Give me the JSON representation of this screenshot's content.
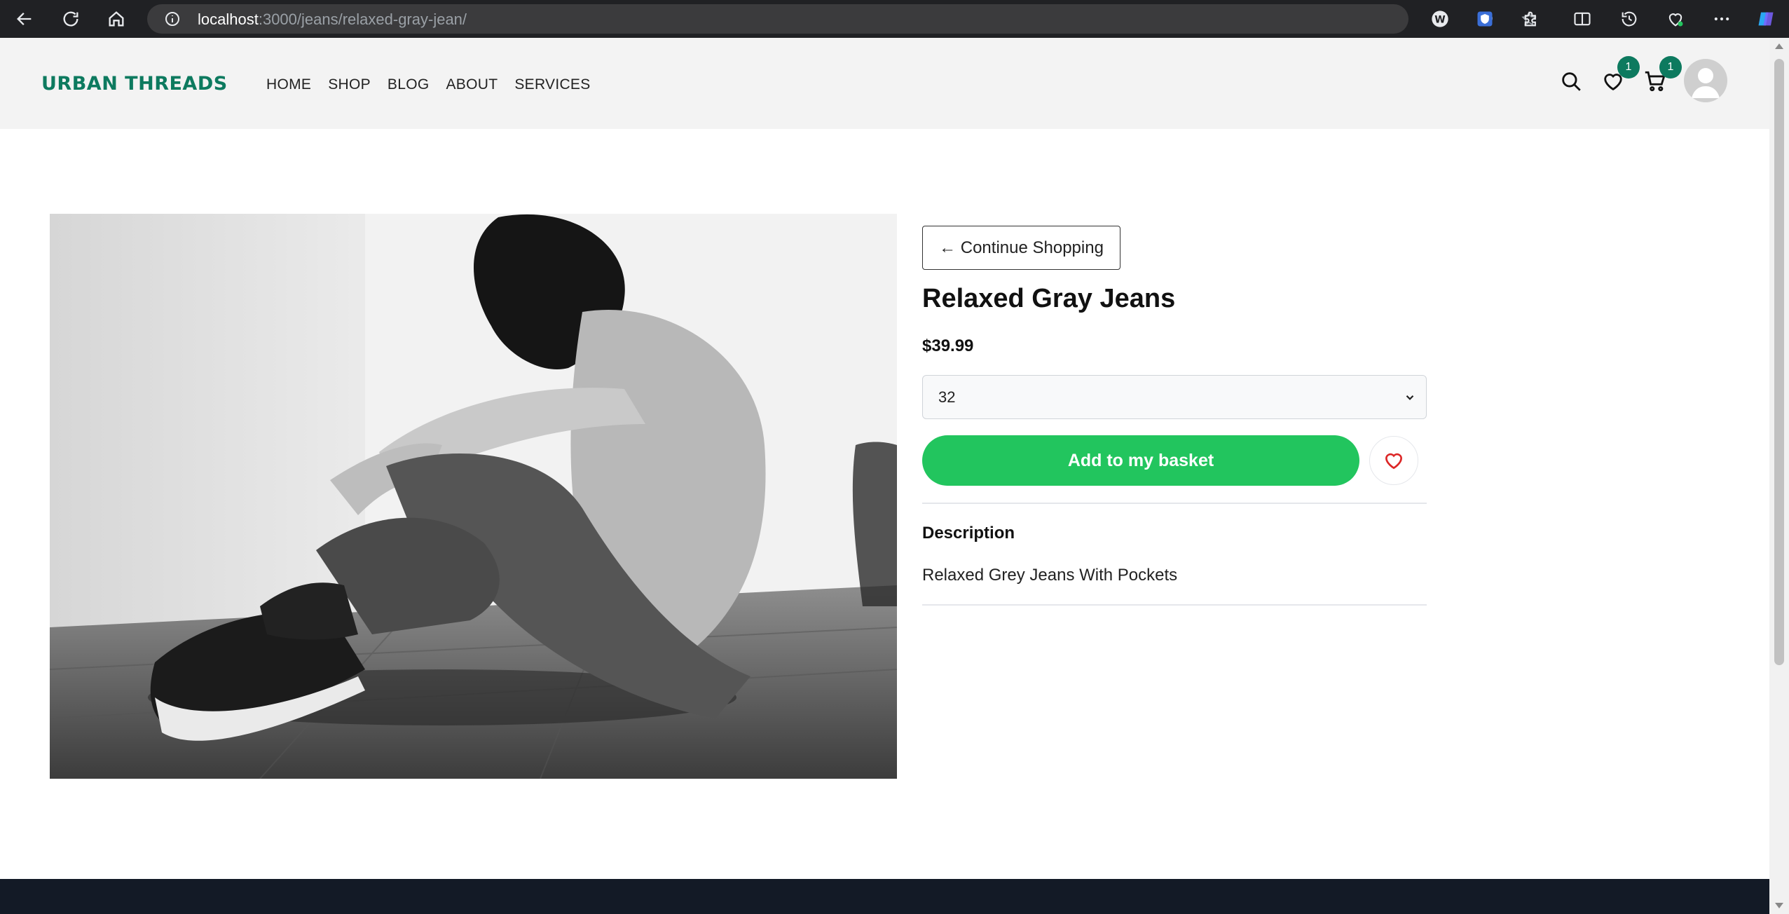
{
  "browser": {
    "url_host": "localhost",
    "url_rest": ":3000/jeans/relaxed-gray-jean/"
  },
  "site": {
    "logo": "URBAN THREADS",
    "nav": [
      "HOME",
      "SHOP",
      "BLOG",
      "ABOUT",
      "SERVICES"
    ],
    "wishlist_count": "1",
    "cart_count": "1"
  },
  "product": {
    "continue_label": "← Continue Shopping",
    "title": "Relaxed Gray Jeans",
    "price": "$39.99",
    "selected_size": "32",
    "add_label": "Add to my basket",
    "description_heading": "Description",
    "description_text": "Relaxed Grey Jeans With Pockets"
  },
  "colors": {
    "brand": "#0d7a5f",
    "add_button": "#22c55e",
    "heart": "#dc2626",
    "footer": "#131a26"
  },
  "icons": [
    "back-icon",
    "refresh-icon",
    "home-icon",
    "info-icon",
    "read-aloud-icon",
    "favorite-star-icon",
    "search-icon",
    "heart-icon",
    "cart-icon",
    "user-icon"
  ]
}
